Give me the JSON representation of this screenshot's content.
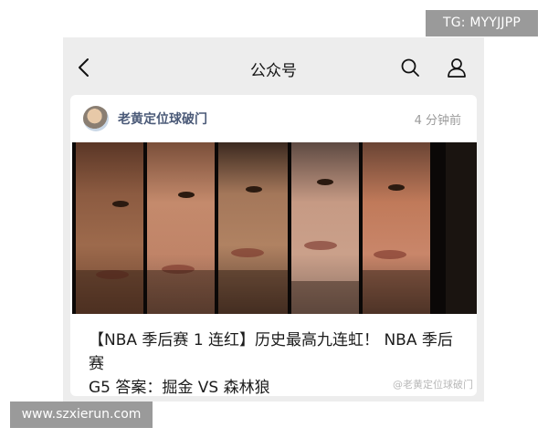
{
  "overlay": {
    "tg_label": "TG: MYYJJPP",
    "site_label": "www.szxierun.com"
  },
  "nav": {
    "title": "公众号",
    "icons": [
      "back-arrow-icon",
      "search-icon",
      "user-icon"
    ]
  },
  "article": {
    "account_name": "老黄定位球破门",
    "time": "4 分钟前",
    "headline_line1": "【NBA 季后赛 1 连红】历史最高九连虹！ NBA 季后赛",
    "headline_line2": "G5 答案：掘金 VS 森林狼",
    "watermark": "@老黄定位球破门"
  },
  "colors": {
    "background": "#ededed",
    "card": "#ffffff",
    "account_name": "#4b5a78",
    "overlay_box": "#9a9a9a"
  }
}
